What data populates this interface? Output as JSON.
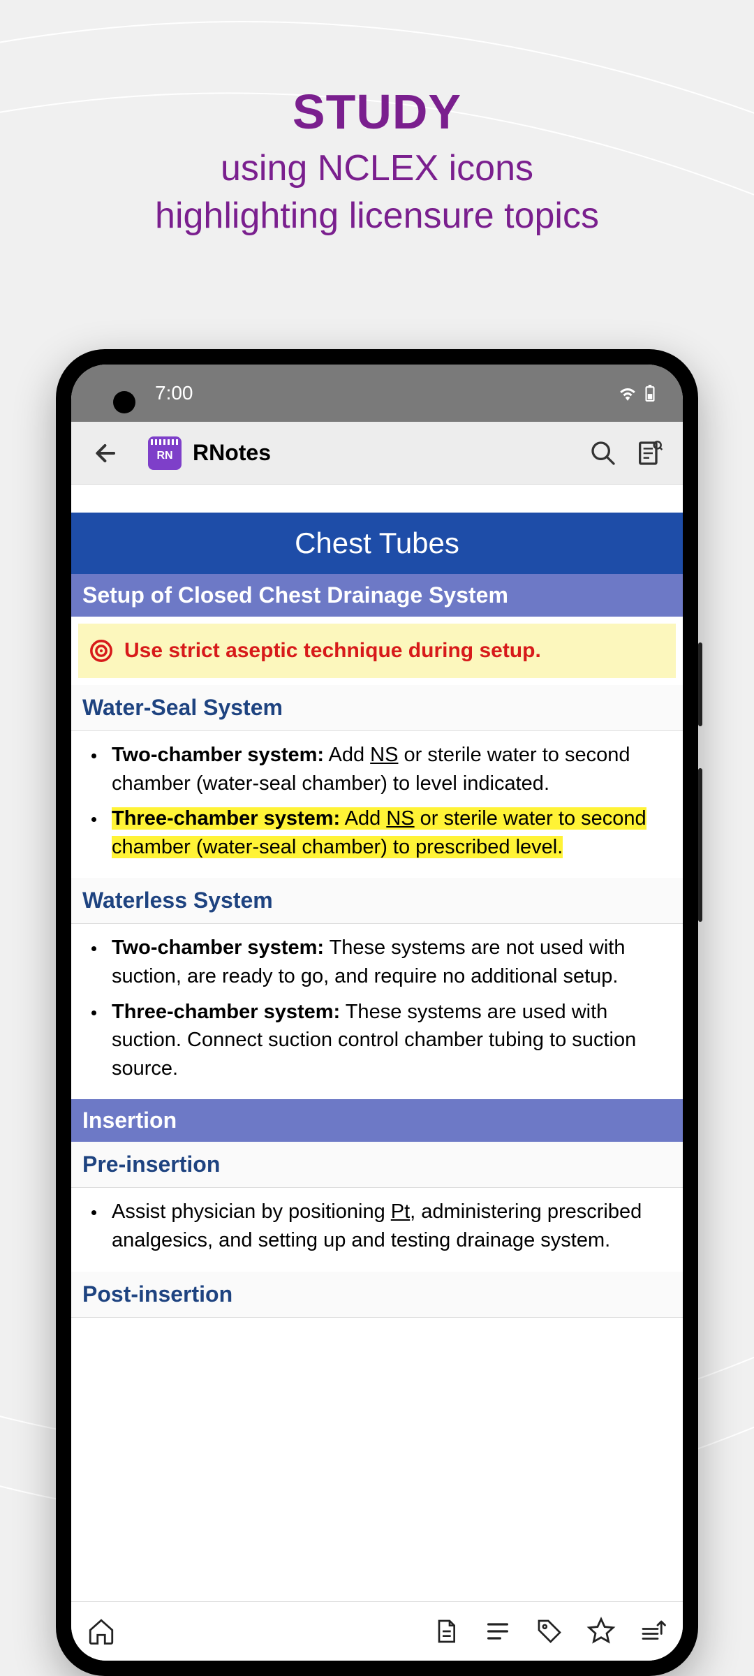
{
  "promo": {
    "title": "STUDY",
    "line1": "using NCLEX icons",
    "line2": "highlighting licensure topics"
  },
  "status": {
    "time": "7:00"
  },
  "appbar": {
    "title": "RNotes",
    "icon_text": "RN"
  },
  "content": {
    "page_title": "Chest Tubes",
    "section1": "Setup of Closed Chest Drainage System",
    "alert": "Use strict aseptic technique during setup.",
    "sub1": "Water-Seal System",
    "s1_i1_label": "Two-chamber system:",
    "s1_i1_text_a": " Add ",
    "s1_i1_ns": "NS",
    "s1_i1_text": " or sterile water to second chamber (water-seal chamber) to level indicated.",
    "s1_i2_label": "Three-chamber system:",
    "s1_i2_text_a": " Add ",
    "s1_i2_ns": "NS",
    "s1_i2_text": " or sterile water to second chamber (water-seal chamber) to prescribed level.",
    "sub2": "Waterless System",
    "s2_i1_label": "Two-chamber system:",
    "s2_i1_text": " These systems are not used with suction, are ready to go, and require no additional setup.",
    "s2_i2_label": "Three-chamber system:",
    "s2_i2_text": " These systems are used with suction. Connect suction control chamber tubing to suction source.",
    "section2": "Insertion",
    "sub3": "Pre-insertion",
    "s3_i1_a": "Assist physician by positioning ",
    "s3_i1_pt": "Pt",
    "s3_i1_b": ", administering prescribed analgesics, and setting up and testing drainage system.",
    "sub4": "Post-insertion"
  }
}
